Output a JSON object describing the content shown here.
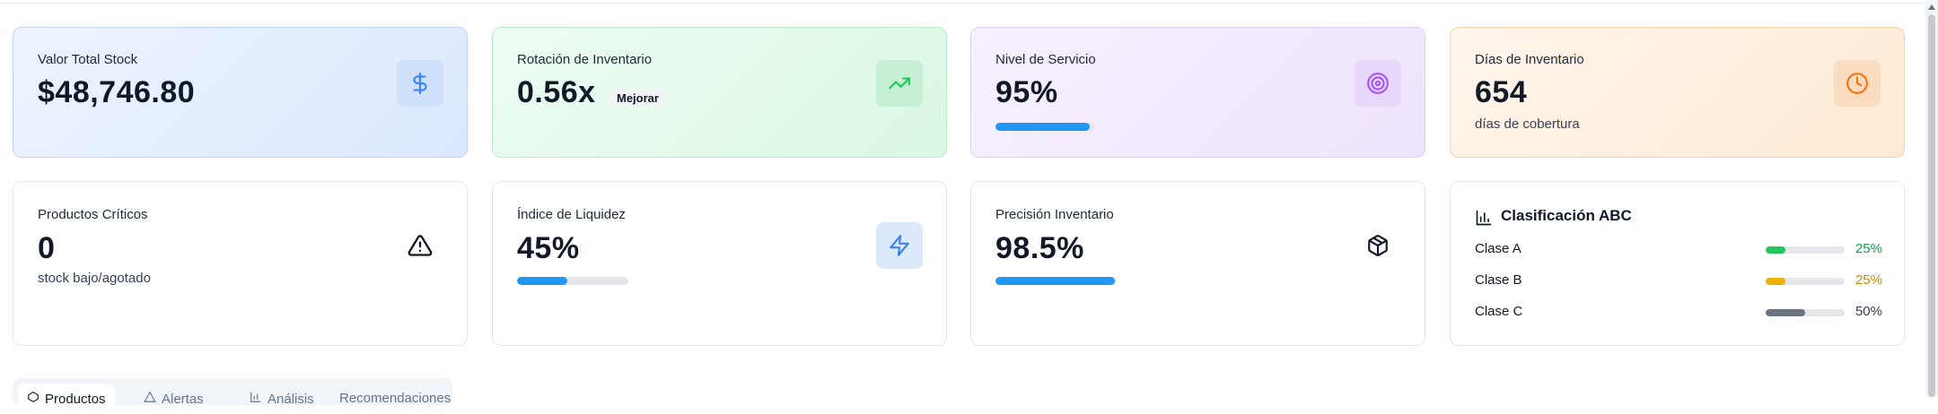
{
  "kpis": {
    "total_value": {
      "label": "Valor Total Stock",
      "value": "$48,746.80",
      "icon": "dollar-icon",
      "accent": "#3b82f6"
    },
    "turnover": {
      "label": "Rotación de Inventario",
      "value": "0.56x",
      "badge": "Mejorar",
      "icon": "trending-up-icon",
      "accent": "#22c55e"
    },
    "service_level": {
      "label": "Nivel de Servicio",
      "value": "95%",
      "progress": 0.95,
      "icon": "target-icon",
      "accent": "#a855f7"
    },
    "inventory_days": {
      "label": "Días de Inventario",
      "value": "654",
      "sub": "días de cobertura",
      "icon": "clock-icon",
      "accent": "#f97316"
    },
    "critical_products": {
      "label": "Productos Críticos",
      "value": "0",
      "sub": "stock bajo/agotado",
      "icon": "warning-icon"
    },
    "liquidity": {
      "label": "Índice de Liquidez",
      "value": "45%",
      "progress": 0.45,
      "icon": "zap-icon",
      "accent": "#3b82f6"
    },
    "accuracy": {
      "label": "Precisión Inventario",
      "value": "98.5%",
      "progress": 0.985,
      "icon": "package-icon"
    }
  },
  "abc": {
    "title": "Clasificación ABC",
    "icon": "bar-chart-icon",
    "classes": [
      {
        "name": "Clase A",
        "percent": "25%",
        "fraction": 0.25,
        "color": "#22c55e"
      },
      {
        "name": "Clase B",
        "percent": "25%",
        "fraction": 0.25,
        "color": "#eab308"
      },
      {
        "name": "Clase C",
        "percent": "50%",
        "fraction": 0.5,
        "color": "#6b7280"
      }
    ]
  },
  "tabs": [
    {
      "label": "Productos",
      "icon": "package-icon",
      "active": true
    },
    {
      "label": "Alertas",
      "icon": "warning-icon",
      "active": false
    },
    {
      "label": "Análisis",
      "icon": "bar-chart-icon",
      "active": false
    },
    {
      "label": "Recomendaciones",
      "icon": "",
      "active": false
    }
  ]
}
